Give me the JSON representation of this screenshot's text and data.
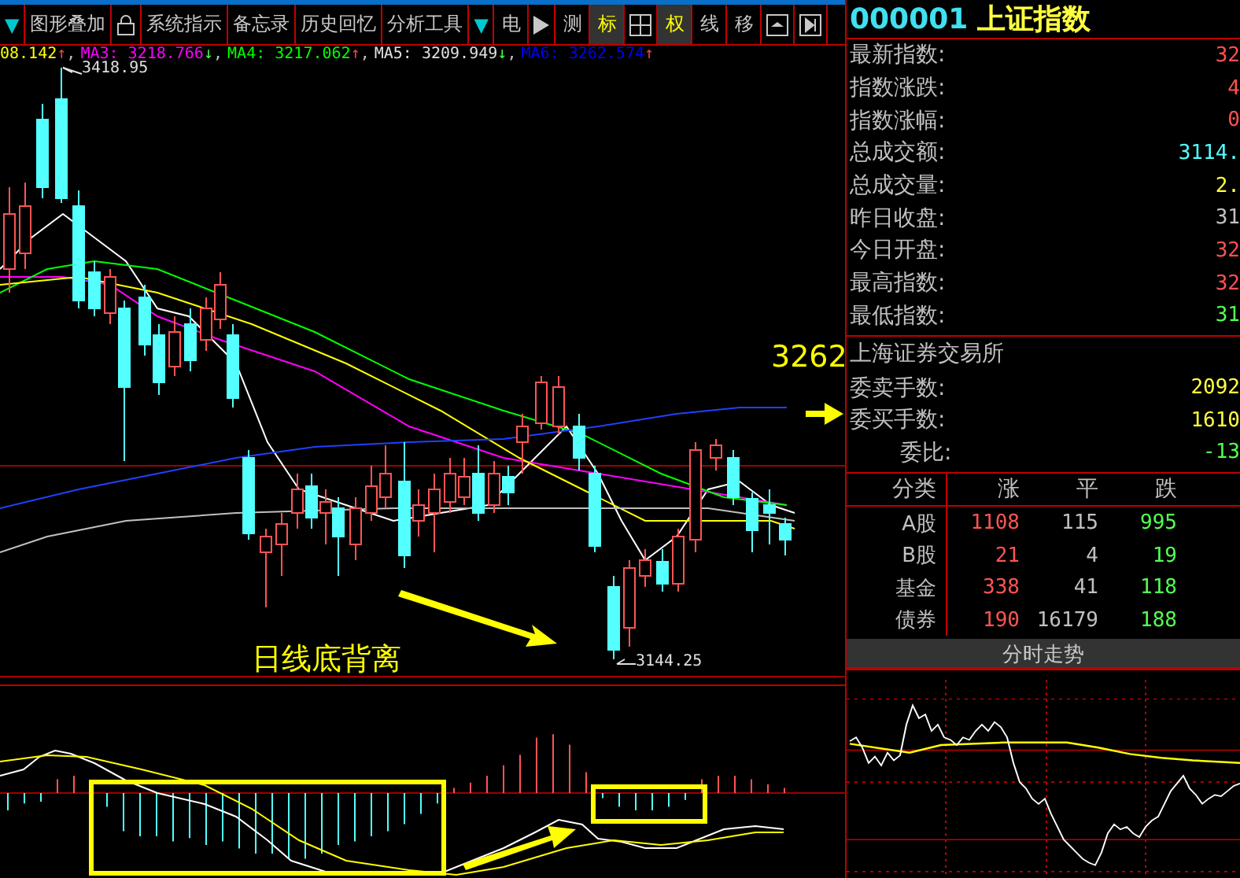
{
  "toolbar": [
    {
      "kind": "arrow",
      "label": "▼",
      "selected": false
    },
    {
      "kind": "text",
      "label": "图形叠加",
      "selected": false
    },
    {
      "kind": "lock",
      "selected": false
    },
    {
      "kind": "text",
      "label": "系统指示",
      "selected": false
    },
    {
      "kind": "text",
      "label": "备忘录",
      "selected": false
    },
    {
      "kind": "text",
      "label": "历史回忆",
      "selected": false
    },
    {
      "kind": "text",
      "label": "分析工具",
      "selected": false
    },
    {
      "kind": "arrow",
      "label": "▼",
      "selected": false
    },
    {
      "kind": "text",
      "label": "电",
      "selected": false
    },
    {
      "kind": "play",
      "selected": false
    },
    {
      "kind": "text",
      "label": "测",
      "selected": false
    },
    {
      "kind": "text",
      "label": "标",
      "selected": true
    },
    {
      "kind": "grid",
      "selected": false
    },
    {
      "kind": "text",
      "label": "权",
      "selected": true
    },
    {
      "kind": "text",
      "label": "线",
      "selected": false
    },
    {
      "kind": "text",
      "label": "移",
      "selected": false
    },
    {
      "kind": "panel",
      "selected": false
    },
    {
      "kind": "skip",
      "selected": false
    }
  ],
  "ma_legend": [
    {
      "text": "08.142",
      "color": "#ffff00",
      "arrow": "↑",
      "up": true,
      "separator": ","
    },
    {
      "text": "MA3: 3218.766",
      "color": "#ff00ff",
      "arrow": "↓",
      "up": false,
      "separator": ","
    },
    {
      "text": "MA4: 3217.062",
      "color": "#00ff00",
      "arrow": "↑",
      "up": true,
      "separator": ","
    },
    {
      "text": "MA5: 3209.949",
      "color": "#e0e0e0",
      "arrow": "↓",
      "up": false,
      "separator": ","
    },
    {
      "text": "MA6: 3262.574",
      "color": "#0000ff",
      "arrow": "↑",
      "up": true
    }
  ],
  "chart": {
    "high_label": "3418.95",
    "low_label": "3144.25",
    "annotation": "日线底背离",
    "price_tag": "3262"
  },
  "quote": {
    "code": "000001",
    "name": "上证指数",
    "rows": [
      {
        "label": "最新指数:",
        "value": "32",
        "color": "#ff5050"
      },
      {
        "label": "指数涨跌:",
        "value": "4",
        "color": "#ff5050"
      },
      {
        "label": "指数涨幅:",
        "value": "0",
        "color": "#ff5050"
      },
      {
        "label": "总成交额:",
        "value": "3114.",
        "color": "#50ffff"
      },
      {
        "label": "总成交量:",
        "value": "2.",
        "color": "#ffff40"
      },
      {
        "label": "昨日收盘:",
        "value": "31",
        "color": "#c0c0c0"
      },
      {
        "label": "今日开盘:",
        "value": "32",
        "color": "#ff5050"
      },
      {
        "label": "最高指数:",
        "value": "32",
        "color": "#ff5050"
      },
      {
        "label": "最低指数:",
        "value": "31",
        "color": "#50ff50"
      }
    ],
    "exchange": "上海证券交易所",
    "orders": [
      {
        "label": "委卖手数:",
        "value": "2092",
        "color": "#ffff40"
      },
      {
        "label": "委买手数:",
        "value": "1610",
        "color": "#ffff40"
      },
      {
        "label": "委比:",
        "value": "-13",
        "color": "#50ff50"
      }
    ],
    "breadth_columns": [
      "分类",
      "涨",
      "平",
      "跌"
    ],
    "breadth_rows": [
      {
        "name": "A股",
        "up": "1108",
        "flat": "115",
        "down": "995"
      },
      {
        "name": "B股",
        "up": "21",
        "flat": "4",
        "down": "19"
      },
      {
        "name": "基金",
        "up": "338",
        "flat": "41",
        "down": "118"
      },
      {
        "name": "债券",
        "up": "190",
        "flat": "16179",
        "down": "188"
      }
    ],
    "intraday_button": "分时走势"
  }
}
